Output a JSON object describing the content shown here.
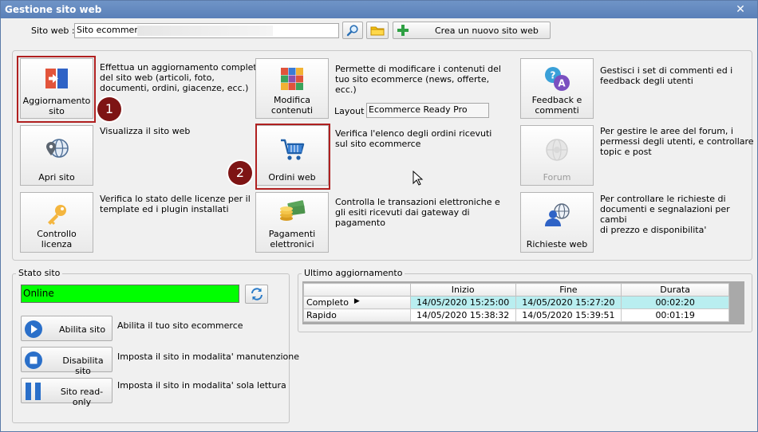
{
  "window": {
    "title": "Gestione sito web"
  },
  "site": {
    "label": "Sito web :",
    "value": "Sito ecommerce",
    "new_site_label": "Crea un nuovo sito web"
  },
  "tiles": {
    "update": {
      "label_line1": "Aggiornamento",
      "label_line2": "sito",
      "desc": [
        "Effettua un aggiornamento completo",
        "del sito web (articoli, foto,",
        "documenti, ordini, giacenze, ecc.)"
      ]
    },
    "open": {
      "label": "Apri sito",
      "desc": [
        "Visualizza il sito web"
      ]
    },
    "license": {
      "label": "Controllo licenza",
      "desc": [
        "Verifica lo stato delle licenze per il",
        "template ed i plugin installati"
      ]
    },
    "edit": {
      "label_line1": "Modifica",
      "label_line2": "contenuti",
      "desc": [
        "Permette di modificare i contenuti del",
        "tuo sito ecommerce (news, offerte,",
        "ecc.)"
      ]
    },
    "orders": {
      "label": "Ordini web",
      "desc": [
        "Verifica l'elenco degli ordini ricevuti",
        "sul sito ecommerce"
      ]
    },
    "payments": {
      "label_line1": "Pagamenti",
      "label_line2": "elettronici",
      "desc": [
        "Controlla le transazioni elettroniche e",
        "gli esiti ricevuti dai gateway di",
        "pagamento"
      ]
    },
    "feedback": {
      "label_line1": "Feedback e",
      "label_line2": "commenti",
      "desc": [
        "Gestisci i set di commenti ed i",
        "feedback degli utenti"
      ]
    },
    "forum": {
      "label": "Forum",
      "desc": [
        "Per gestire le aree del forum, i",
        "permessi degli utenti, e controllare",
        "topic e post"
      ]
    },
    "requests": {
      "label": "Richieste web",
      "desc": [
        "Per controllare le richieste di",
        "documenti e segnalazioni per cambi",
        "di prezzo e disponibilita'"
      ]
    }
  },
  "layout_field": {
    "label": "Layout :",
    "value": "Ecommerce Ready Pro"
  },
  "badges": {
    "one": "1",
    "two": "2"
  },
  "status": {
    "legend": "Stato sito",
    "value": "Online",
    "enable_label": "Abilita sito",
    "enable_desc": "Abilita il tuo sito ecommerce",
    "disable_label": "Disabilita sito",
    "disable_desc": "Imposta il sito in modalita' manutenzione",
    "readonly_label": "Sito read-only",
    "readonly_desc": "Imposta il sito in modalita' sola lettura"
  },
  "last_update": {
    "legend": "Ultimo aggiornamento",
    "columns": [
      "",
      "Inizio",
      "Fine",
      "Durata"
    ],
    "rows": [
      {
        "name": "Completo",
        "start": "14/05/2020 15:25:00",
        "end": "14/05/2020 15:27:20",
        "duration": "00:02:20"
      },
      {
        "name": "Rapido",
        "start": "14/05/2020 15:38:32",
        "end": "14/05/2020 15:39:51",
        "duration": "00:01:19"
      }
    ]
  },
  "colors": {
    "accent_red": "#b02020",
    "badge": "#7e1414",
    "online_green": "#00ff00",
    "selection": "#b9eef0",
    "titlebar": "#5a80b8"
  }
}
